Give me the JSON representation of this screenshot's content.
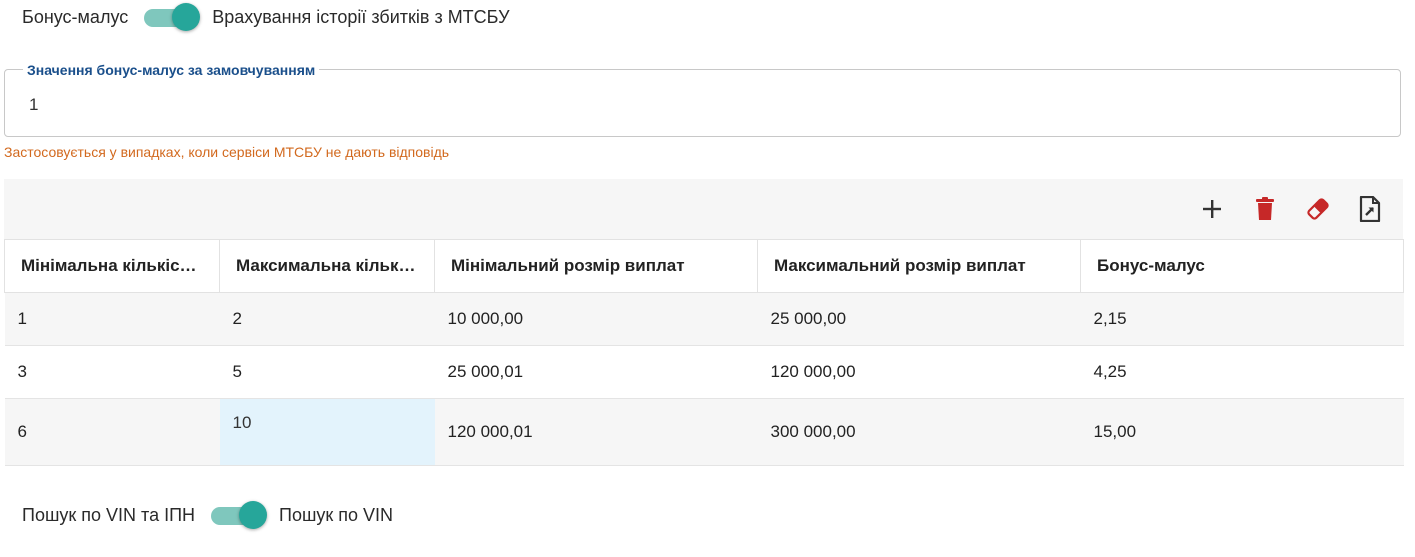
{
  "bonus_toggle": {
    "left_label": "Бонус-малус",
    "right_label": "Врахування історії збитків з МТСБУ",
    "active": "right"
  },
  "default_field": {
    "legend": "Значення бонус-малус за замовчуванням",
    "value": "1",
    "hint": "Застосовується у випадках, коли сервіси МТСБУ не дають відповідь"
  },
  "toolbar": {
    "icons": [
      "plus-icon",
      "trash-icon",
      "eraser-icon",
      "export-file-icon"
    ],
    "colors": {
      "plus": "#333333",
      "trash": "#c62828",
      "eraser": "#c62828",
      "export": "#333333"
    }
  },
  "table": {
    "columns": [
      "Мінімальна кількіс…",
      "Максимальна кільк…",
      "Мінімальний розмір виплат",
      "Максимальний розмір виплат",
      "Бонус-малус"
    ],
    "rows": [
      [
        "1",
        "2",
        "10 000,00",
        "25 000,00",
        "2,15"
      ],
      [
        "3",
        "5",
        "25 000,01",
        "120 000,00",
        "4,25"
      ],
      [
        "6",
        "10",
        "120 000,01",
        "300 000,00",
        "15,00"
      ]
    ],
    "selected_cell": {
      "row": 2,
      "col": 1
    }
  },
  "search_toggle": {
    "left_label": "Пошук по VIN та ІПН",
    "right_label": "Пошук по VIN",
    "active": "right"
  },
  "colors": {
    "accent": "#26a69a",
    "accent_track": "#7fc7bd",
    "legend": "#1a4f8b",
    "hint": "#d2691e",
    "selected_cell": "#e3f3fc"
  }
}
